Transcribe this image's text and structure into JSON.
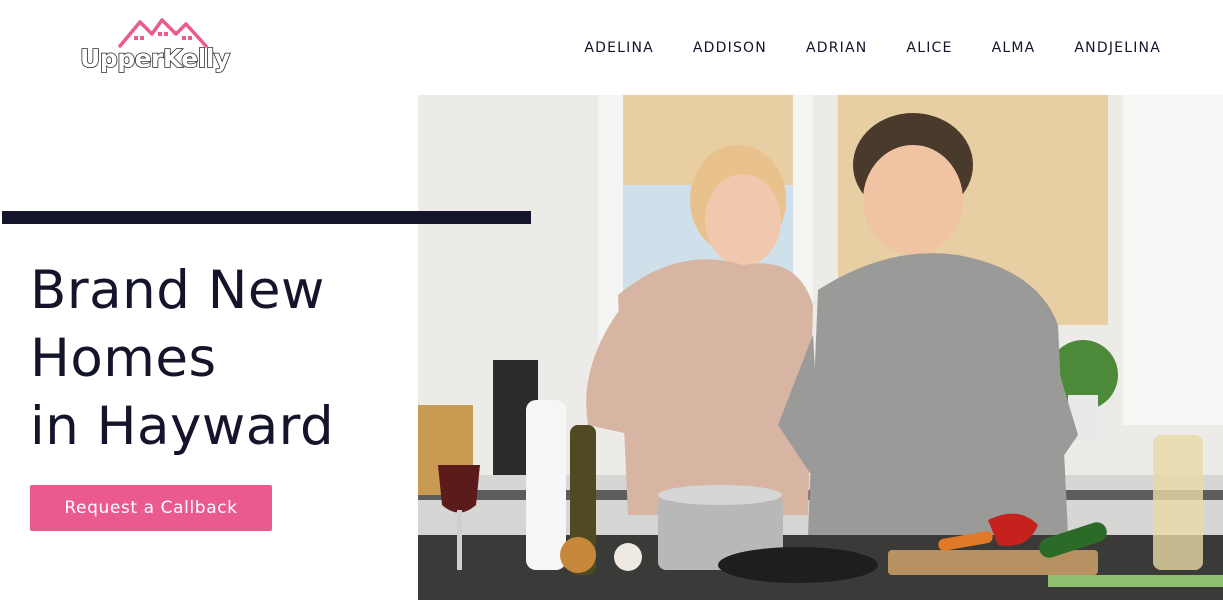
{
  "brand": {
    "name": "UpperKelly",
    "accent_color": "#ea5a8f",
    "dark_color": "#14142b"
  },
  "nav": {
    "items": [
      "ADELINA",
      "ADDISON",
      "ADRIAN",
      "ALICE",
      "ALMA",
      "ANDJELINA"
    ]
  },
  "hero": {
    "headline_lines": [
      "Brand New",
      "Homes",
      "in Hayward"
    ],
    "cta_label": "Request a Callback",
    "image_subject": "couple cooking in a kitchen"
  }
}
